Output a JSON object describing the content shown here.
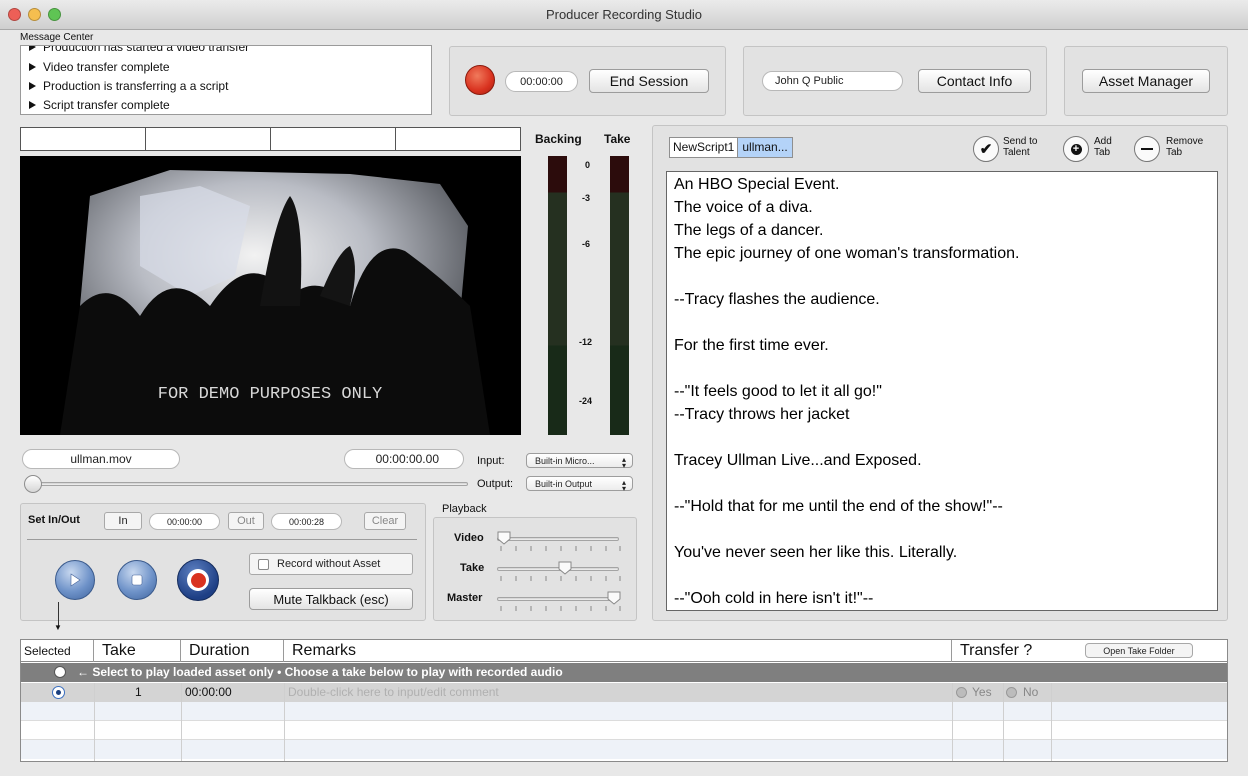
{
  "window": {
    "title": "Producer Recording Studio"
  },
  "message_center": {
    "label": "Message Center",
    "items": [
      "Production has started a video transfer",
      "Video transfer complete",
      "Production is transferring a a script",
      "Script transfer complete"
    ]
  },
  "session": {
    "time": "00:00:00",
    "end_label": "End Session"
  },
  "contact": {
    "name": "John Q Public",
    "button_label": "Contact Info"
  },
  "asset_manager": {
    "label": "Asset Manager"
  },
  "meters": {
    "backing_label": "Backing",
    "take_label": "Take",
    "ticks": [
      "0",
      "-3",
      "-6",
      "-12",
      "-24"
    ]
  },
  "video": {
    "overlay_text": "FOR DEMO PURPOSES ONLY",
    "filename": "ullman.mov",
    "timecode": "00:00:00.00",
    "position_fraction": 0.0
  },
  "io": {
    "input_label": "Input:",
    "input_value": "Built-in Micro...",
    "output_label": "Output:",
    "output_value": "Built-in Output"
  },
  "inout": {
    "label": "Set In/Out",
    "in_label": "In",
    "in_time": "00:00:00",
    "out_label": "Out",
    "out_time": "00:00:28",
    "clear_label": "Clear"
  },
  "record": {
    "without_asset_label": "Record without Asset",
    "mute_label": "Mute Talkback (esc)"
  },
  "playback": {
    "label": "Playback",
    "video_label": "Video",
    "take_label": "Take",
    "master_label": "Master",
    "video_level": 0.0,
    "take_level": 0.55,
    "master_level": 1.0
  },
  "script": {
    "tabs": [
      "NewScript1",
      "ullman..."
    ],
    "send_label": "Send to\nTalent",
    "add_label": "Add\nTab",
    "remove_label": "Remove\nTab",
    "lines": [
      "An HBO Special Event.",
      "The voice of a diva.",
      "The legs of a dancer.",
      "The epic journey of one woman's transformation.",
      "",
      "--Tracy flashes the audience.",
      "",
      "For the first time ever.",
      "",
      "--\"It feels good to let it all go!\"",
      "--Tracy throws her jacket",
      "",
      "Tracey Ullman Live...and Exposed.",
      "",
      "--\"Hold that for me until the end of the show!\"--",
      "",
      "You've never seen her like this. Literally.",
      "",
      "--\"Ooh cold in here isn't it!\"--"
    ]
  },
  "takes": {
    "headers": {
      "selected": "Selected",
      "take": "Take",
      "duration": "Duration",
      "remarks": "Remarks",
      "transfer": "Transfer ?"
    },
    "open_folder_label": "Open Take Folder",
    "banner": "← Select to play loaded asset only • Choose a take below to play with recorded audio",
    "rows": [
      {
        "take": "1",
        "duration": "00:00:00",
        "remarks": "Double-click here to input/edit comment",
        "yes": "Yes",
        "no": "No"
      }
    ]
  },
  "colors": {
    "record_red": "#d9321f",
    "play_blue": "#4f7ab8",
    "selection_blue": "#b4d3f8"
  }
}
